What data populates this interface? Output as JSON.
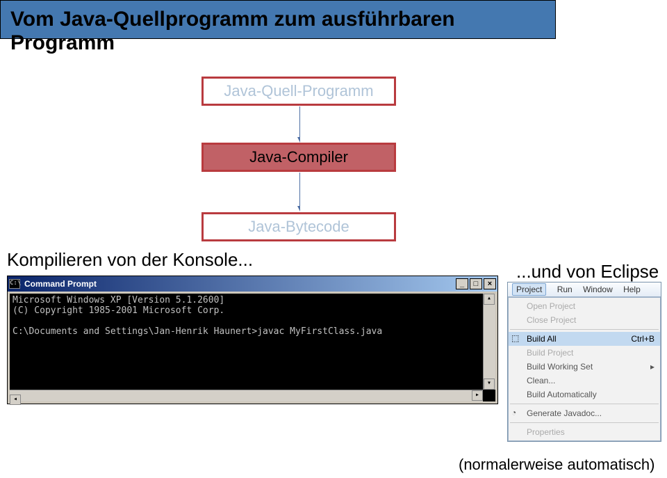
{
  "title": "Vom Java-Quellprogramm zum ausführbaren Programm",
  "flow": {
    "source": "Java-Quell-Programm",
    "compiler": "Java-Compiler",
    "bytecode": "Java-Bytecode"
  },
  "captions": {
    "left": "Kompilieren von der Konsole...",
    "right": "...und von Eclipse",
    "footnote": "(normalerweise automatisch)"
  },
  "cmd": {
    "icon_text": "C:\\",
    "title": "Command Prompt",
    "buttons": {
      "min": "_",
      "max": "□",
      "close": "×"
    },
    "lines": [
      "Microsoft Windows XP [Version 5.1.2600]",
      "(C) Copyright 1985-2001 Microsoft Corp.",
      "",
      "C:\\Documents and Settings\\Jan-Henrik Haunert>javac MyFirstClass.java"
    ]
  },
  "eclipse": {
    "menubar": [
      "Project",
      "Run",
      "Window",
      "Help"
    ],
    "active_menu_index": 0,
    "items": [
      {
        "label": "Open Project",
        "disabled": true
      },
      {
        "label": "Close Project",
        "disabled": true
      },
      {
        "sep": true
      },
      {
        "label": "Build All",
        "selected": true,
        "shortcut": "Ctrl+B",
        "icon": "⬚"
      },
      {
        "label": "Build Project",
        "disabled": true
      },
      {
        "label": "Build Working Set",
        "submenu": true
      },
      {
        "label": "Clean..."
      },
      {
        "label": "Build Automatically"
      },
      {
        "sep": true
      },
      {
        "label": "Generate Javadoc...",
        "icon": "◔"
      },
      {
        "sep": true
      },
      {
        "label": "Properties",
        "disabled": true
      }
    ]
  }
}
